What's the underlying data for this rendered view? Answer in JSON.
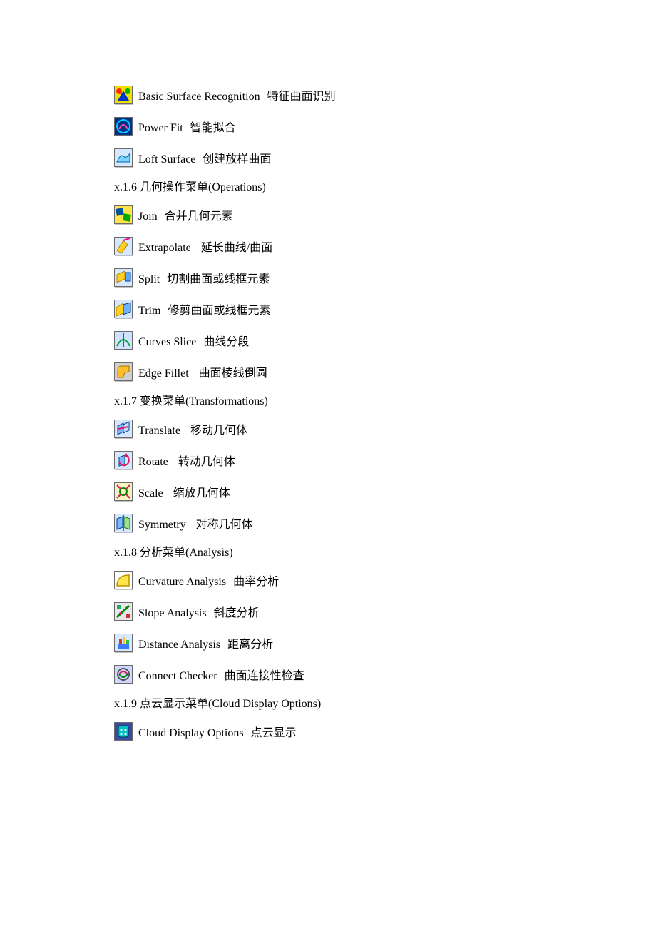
{
  "items": [
    {
      "type": "item",
      "icon": "basic-surface-recognition-icon",
      "en": "Basic Surface Recognition",
      "zh": "特征曲面识别"
    },
    {
      "type": "item",
      "icon": "power-fit-icon",
      "en": "Power Fit",
      "zh": "智能拟合"
    },
    {
      "type": "item",
      "icon": "loft-surface-icon",
      "en": "Loft Surface",
      "zh": "创建放样曲面"
    },
    {
      "type": "heading",
      "text": "x.1.6  几何操作菜单(Operations)"
    },
    {
      "type": "item",
      "icon": "join-icon",
      "en": "Join",
      "zh": "合并几何元素",
      "sp": ""
    },
    {
      "type": "item",
      "icon": "extrapolate-icon",
      "en": "Extrapolate",
      "zh": "延长曲线/曲面",
      "sp": "  "
    },
    {
      "type": "item",
      "icon": "split-icon",
      "en": "Split",
      "zh": "切割曲面或线框元素"
    },
    {
      "type": "item",
      "icon": "trim-icon",
      "en": "Trim",
      "zh": "修剪曲面或线框元素"
    },
    {
      "type": "item",
      "icon": "curves-slice-icon",
      "en": "Curves Slice",
      "zh": "曲线分段"
    },
    {
      "type": "item",
      "icon": "edge-fillet-icon",
      "en": "Edge Fillet",
      "zh": "曲面棱线倒圆",
      "sp": "  "
    },
    {
      "type": "heading",
      "text": "x.1.7  变换菜单(Transformations)"
    },
    {
      "type": "item",
      "icon": "translate-icon",
      "en": "Translate",
      "zh": "移动几何体",
      "sp": "  "
    },
    {
      "type": "item",
      "icon": "rotate-icon",
      "en": "Rotate",
      "zh": "转动几何体",
      "sp": "  "
    },
    {
      "type": "item",
      "icon": "scale-icon",
      "en": "Scale",
      "zh": "缩放几何体",
      "sp": "  "
    },
    {
      "type": "item",
      "icon": "symmetry-icon",
      "en": "Symmetry",
      "zh": "对称几何体",
      "sp": "  "
    },
    {
      "type": "heading",
      "text": "x.1.8  分析菜单(Analysis)"
    },
    {
      "type": "item",
      "icon": "curvature-analysis-icon",
      "en": "Curvature Analysis",
      "zh": "曲率分析"
    },
    {
      "type": "item",
      "icon": "slope-analysis-icon",
      "en": "Slope Analysis",
      "zh": "斜度分析"
    },
    {
      "type": "item",
      "icon": "distance-analysis-icon",
      "en": "Distance Analysis",
      "zh": "距离分析"
    },
    {
      "type": "item",
      "icon": "connect-checker-icon",
      "en": "Connect Checker",
      "zh": "曲面连接性检查"
    },
    {
      "type": "heading",
      "text": "x.1.9 点云显示菜单(Cloud Display Options)"
    },
    {
      "type": "item",
      "icon": "cloud-display-options-icon",
      "en": "Cloud Display Options",
      "zh": "点云显示"
    }
  ]
}
